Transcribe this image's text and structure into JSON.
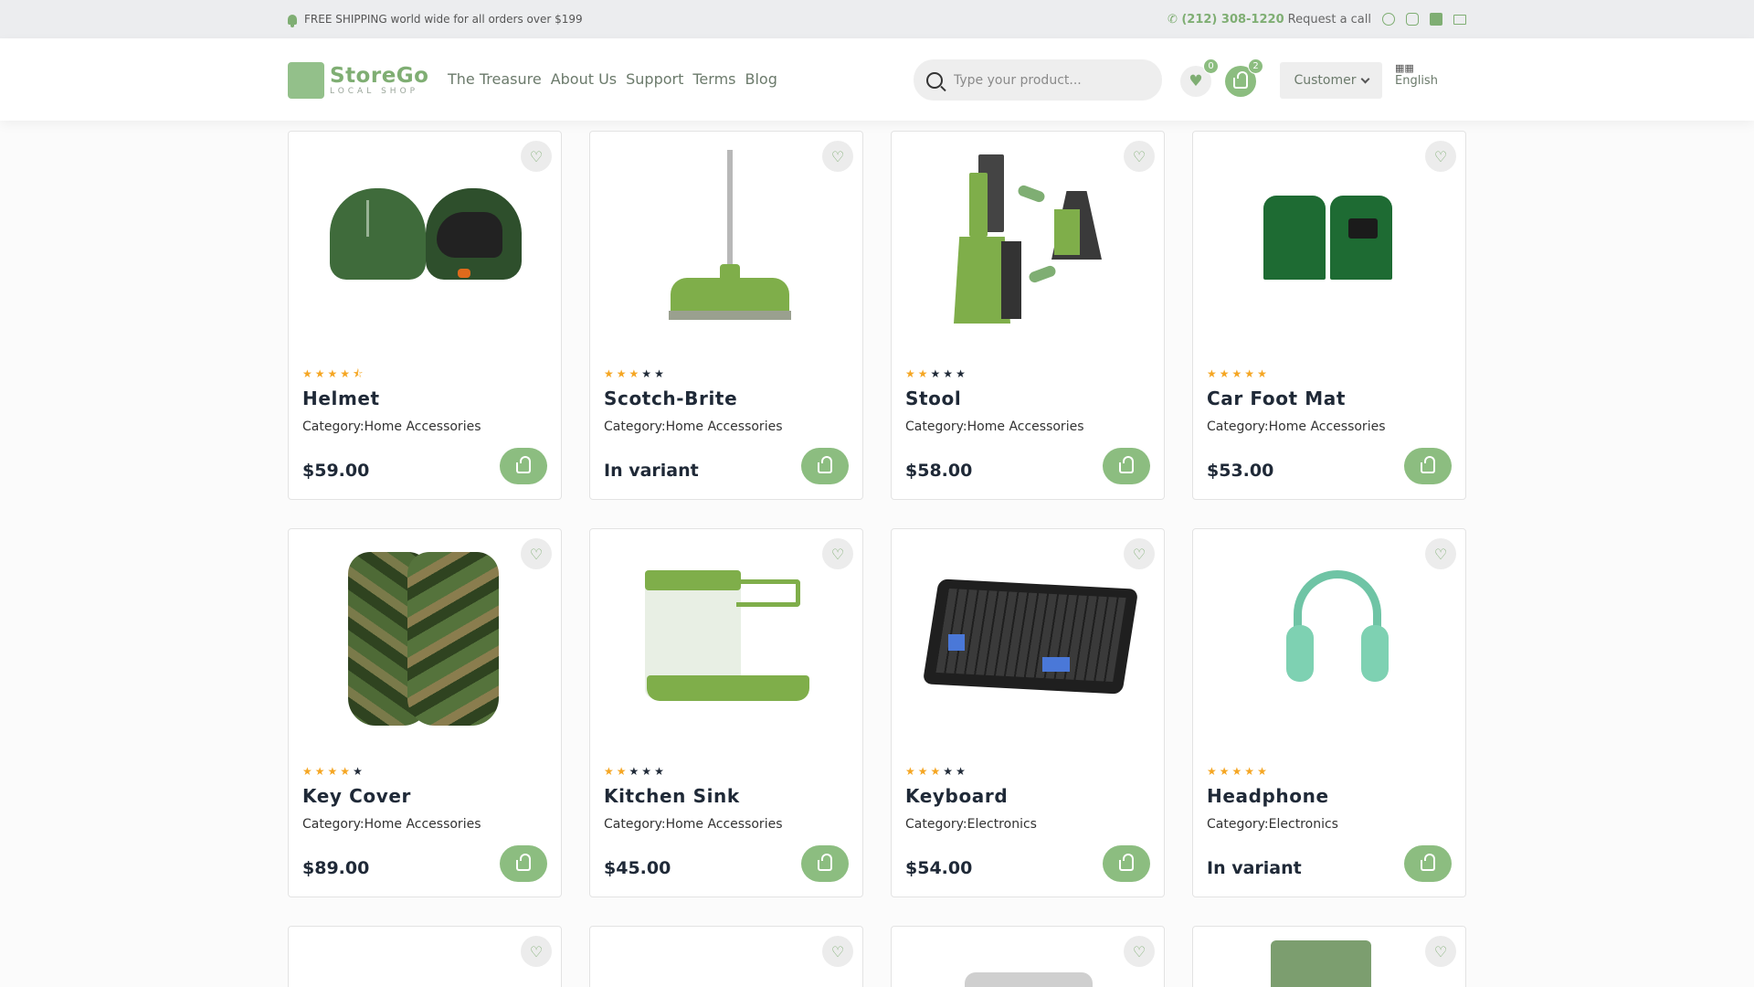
{
  "topbar": {
    "shipping_text": "FREE SHIPPING world wide for all orders over $199",
    "phone": "(212) 308-1220",
    "request_call": "Request a call"
  },
  "header": {
    "logo_name": "StoreGo",
    "logo_sub": "LOCAL SHOP",
    "nav": [
      "The Treasure",
      "About Us",
      "Support",
      "Terms",
      "Blog"
    ],
    "search_placeholder": "Type your product...",
    "wishlist_count": "0",
    "cart_count": "2",
    "customer_label": "Customer",
    "language": "English"
  },
  "colors": {
    "accent": "#8cbd80",
    "star_on": "#f5a623",
    "star_off": "#1f2937"
  },
  "products": [
    {
      "name": "Helmet",
      "category": "Category:Home Accessories",
      "price": "$59.00",
      "rating": 4.5
    },
    {
      "name": "Scotch-Brite",
      "category": "Category:Home Accessories",
      "price": "In variant",
      "rating": 3
    },
    {
      "name": "Stool",
      "category": "Category:Home Accessories",
      "price": "$58.00",
      "rating": 2
    },
    {
      "name": "Car Foot Mat",
      "category": "Category:Home Accessories",
      "price": "$53.00",
      "rating": 5
    },
    {
      "name": "Key Cover",
      "category": "Category:Home Accessories",
      "price": "$89.00",
      "rating": 4
    },
    {
      "name": "Kitchen Sink",
      "category": "Category:Home Accessories",
      "price": "$45.00",
      "rating": 2
    },
    {
      "name": "Keyboard",
      "category": "Category:Electronics",
      "price": "$54.00",
      "rating": 3
    },
    {
      "name": "Headphone",
      "category": "Category:Electronics",
      "price": "In variant",
      "rating": 5
    }
  ]
}
